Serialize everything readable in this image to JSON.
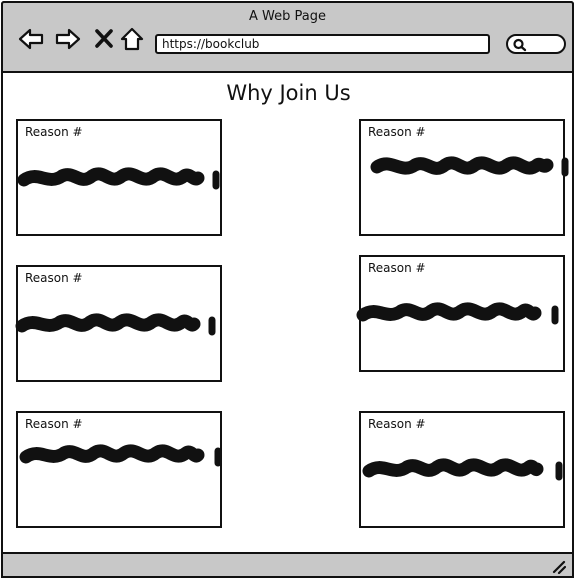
{
  "window": {
    "title": "A Web Page"
  },
  "browser": {
    "url": "https://bookclub"
  },
  "page": {
    "heading": "Why Join Us"
  },
  "cards": [
    {
      "label": "Reason #"
    },
    {
      "label": "Reason #"
    },
    {
      "label": "Reason #"
    },
    {
      "label": "Reason #"
    },
    {
      "label": "Reason #"
    },
    {
      "label": "Reason #"
    }
  ],
  "icons": {
    "back": "back-arrow-icon",
    "forward": "forward-arrow-icon",
    "close": "close-icon",
    "home": "home-icon",
    "search": "search-icon",
    "resize": "resize-grip-icon"
  }
}
